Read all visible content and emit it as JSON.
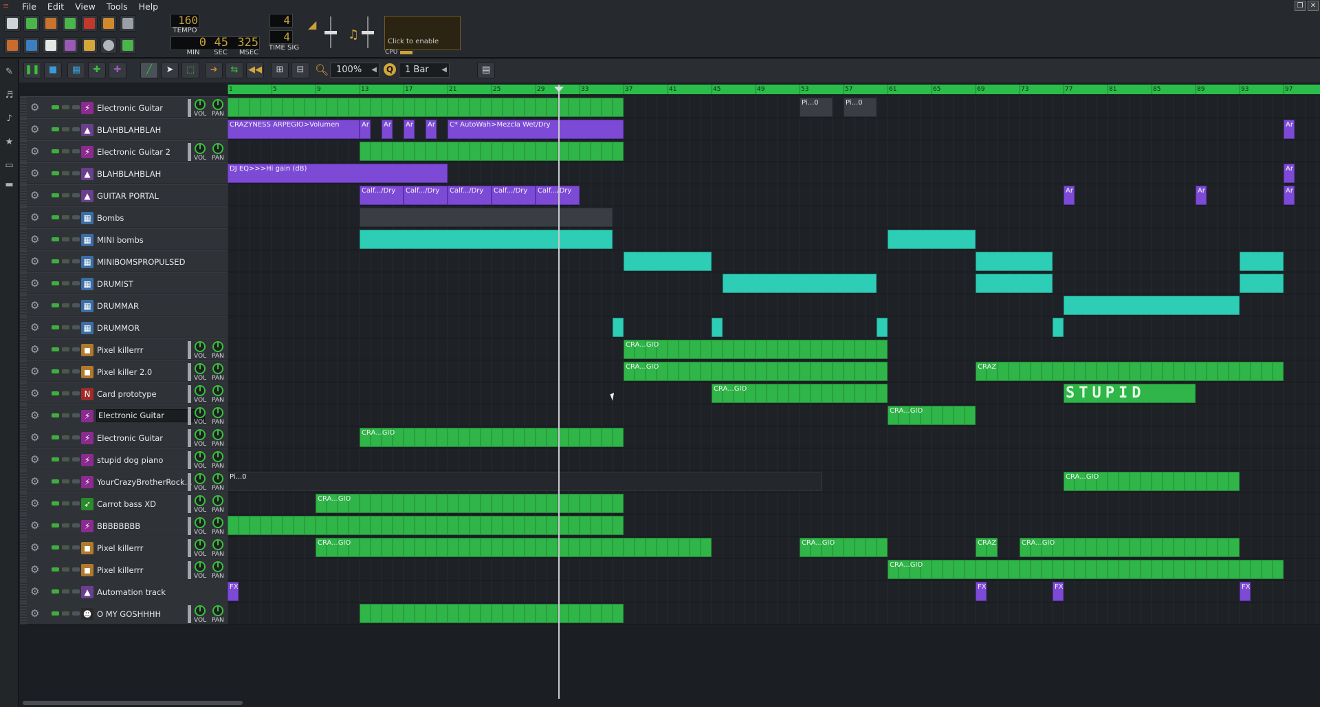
{
  "menu": {
    "items": [
      "File",
      "Edit",
      "View",
      "Tools",
      "Help"
    ]
  },
  "transport": {
    "tempo_value": "160",
    "tempo_label": "TEMPO",
    "min_value": "0",
    "min_label": "MIN",
    "sec_value": "45",
    "sec_label": "SEC",
    "msec_value": "325",
    "msec_label": "MSEC",
    "timesig_num": "4",
    "timesig_den": "4",
    "timesig_label": "TIME SIG",
    "cpu_hint": "Click to enable",
    "cpu_label": "CPU"
  },
  "editor_toolbar": {
    "zoom_value": "100%",
    "quantize_label": "Q",
    "quantize_value": "1 Bar"
  },
  "ruler": {
    "ticks": [
      "1",
      "5",
      "9",
      "13",
      "17",
      "21",
      "25",
      "29",
      "33",
      "37",
      "41",
      "45",
      "49",
      "53",
      "57",
      "61",
      "65",
      "69",
      "73",
      "77",
      "81",
      "85",
      "89",
      "93",
      "97"
    ]
  },
  "tracks": [
    {
      "name": "Electronic Guitar",
      "icon": "guitar-plugin-icon",
      "color": "#8b2a8f",
      "vol": "VOL",
      "pan": "PAN",
      "knobs": true
    },
    {
      "name": "BLAHBLAHBLAH",
      "icon": "automation-icon",
      "color": "#6a3f8c",
      "knobs": false
    },
    {
      "name": "Electronic Guitar 2",
      "icon": "guitar-plugin-icon",
      "color": "#8b2a8f",
      "vol": "VOL",
      "pan": "PAN",
      "knobs": true
    },
    {
      "name": "BLAHBLAHBLAH",
      "icon": "automation-icon",
      "color": "#6a3f8c",
      "knobs": false
    },
    {
      "name": "GUITAR PORTAL",
      "icon": "automation-icon",
      "color": "#6a3f8c",
      "knobs": false
    },
    {
      "name": "Bombs",
      "icon": "pattern-icon",
      "color": "#3b6ea5",
      "knobs": false
    },
    {
      "name": "MINI bombs",
      "icon": "pattern-icon",
      "color": "#3b6ea5",
      "knobs": false
    },
    {
      "name": "MINIBOMSPROPULSED",
      "icon": "pattern-icon",
      "color": "#3b6ea5",
      "knobs": false
    },
    {
      "name": "DRUMIST",
      "icon": "pattern-icon",
      "color": "#3b6ea5",
      "knobs": false
    },
    {
      "name": "DRUMMAR",
      "icon": "pattern-icon",
      "color": "#3b6ea5",
      "knobs": false
    },
    {
      "name": "DRUMMOR",
      "icon": "pattern-icon",
      "color": "#3b6ea5",
      "knobs": false
    },
    {
      "name": "Pixel killerrr",
      "icon": "sampler-icon",
      "color": "#b07a2c",
      "vol": "VOL",
      "pan": "PAN",
      "knobs": true
    },
    {
      "name": "Pixel killer 2.0",
      "icon": "sampler-icon",
      "color": "#b07a2c",
      "vol": "VOL",
      "pan": "PAN",
      "knobs": true
    },
    {
      "name": "Card prototype",
      "icon": "nes-icon",
      "color": "#a02a2a",
      "vol": "VOL",
      "pan": "PAN",
      "knobs": true
    },
    {
      "name": "Electronic Guitar",
      "icon": "guitar-plugin-icon",
      "color": "#8b2a8f",
      "vol": "VOL",
      "pan": "PAN",
      "knobs": true,
      "selected": true
    },
    {
      "name": "Electronic Guitar",
      "icon": "guitar-plugin-icon",
      "color": "#8b2a8f",
      "vol": "VOL",
      "pan": "PAN",
      "knobs": true
    },
    {
      "name": "stupid dog piano",
      "icon": "guitar-plugin-icon",
      "color": "#8b2a8f",
      "vol": "VOL",
      "pan": "PAN",
      "knobs": true
    },
    {
      "name": "YourCrazyBrotherRock...",
      "icon": "guitar-plugin-icon",
      "color": "#8b2a8f",
      "vol": "VOL",
      "pan": "PAN",
      "knobs": true
    },
    {
      "name": "Carrot bass XD",
      "icon": "carrot-icon",
      "color": "#2b8a2b",
      "vol": "VOL",
      "pan": "PAN",
      "knobs": true
    },
    {
      "name": "BBBBBBBB",
      "icon": "guitar-plugin-icon",
      "color": "#8b2a8f",
      "vol": "VOL",
      "pan": "PAN",
      "knobs": true
    },
    {
      "name": "Pixel killerrr",
      "icon": "sampler-icon",
      "color": "#b07a2c",
      "vol": "VOL",
      "pan": "PAN",
      "knobs": true
    },
    {
      "name": "Pixel killerrr",
      "icon": "sampler-icon",
      "color": "#b07a2c",
      "vol": "VOL",
      "pan": "PAN",
      "knobs": true
    },
    {
      "name": "Automation track",
      "icon": "automation-icon",
      "color": "#6a3f8c",
      "knobs": false
    },
    {
      "name": "O MY GOSHHHH",
      "icon": "alien-icon",
      "color": "#2a2a2a",
      "vol": "VOL",
      "pan": "PAN",
      "knobs": true
    }
  ],
  "clips": [
    {
      "row": 0,
      "start": 1,
      "len": 36,
      "kind": "green",
      "label": ""
    },
    {
      "row": 0,
      "start": 53,
      "len": 3,
      "kind": "gray",
      "label": "Pi...0"
    },
    {
      "row": 0,
      "start": 57,
      "len": 3,
      "kind": "gray",
      "label": "Pi...0"
    },
    {
      "row": 1,
      "start": 1,
      "len": 12,
      "kind": "purple",
      "label": "CRAZYNESS ARPEGIO>Volumen"
    },
    {
      "row": 1,
      "start": 13,
      "len": 1,
      "kind": "purple",
      "label": "Ar"
    },
    {
      "row": 1,
      "start": 15,
      "len": 1,
      "kind": "purple",
      "label": "Ar"
    },
    {
      "row": 1,
      "start": 17,
      "len": 1,
      "kind": "purple",
      "label": "Ar"
    },
    {
      "row": 1,
      "start": 19,
      "len": 1,
      "kind": "purple",
      "label": "Ar"
    },
    {
      "row": 1,
      "start": 21,
      "len": 16,
      "kind": "purple",
      "label": "C* AutoWah>Mezcla Wet/Dry"
    },
    {
      "row": 1,
      "start": 97,
      "len": 1,
      "kind": "purple",
      "label": "Ar"
    },
    {
      "row": 2,
      "start": 13,
      "len": 24,
      "kind": "green",
      "label": ""
    },
    {
      "row": 3,
      "start": 1,
      "len": 20,
      "kind": "purple",
      "label": "DJ EQ>>>Hi gain (dB)"
    },
    {
      "row": 3,
      "start": 97,
      "len": 1,
      "kind": "purple",
      "label": "Ar"
    },
    {
      "row": 4,
      "start": 13,
      "len": 4,
      "kind": "purple",
      "label": "Calf.../Dry"
    },
    {
      "row": 4,
      "start": 17,
      "len": 4,
      "kind": "purple",
      "label": "Calf.../Dry"
    },
    {
      "row": 4,
      "start": 21,
      "len": 4,
      "kind": "purple",
      "label": "Calf.../Dry"
    },
    {
      "row": 4,
      "start": 25,
      "len": 4,
      "kind": "purple",
      "label": "Calf.../Dry"
    },
    {
      "row": 4,
      "start": 29,
      "len": 4,
      "kind": "purple",
      "label": "Calf.../Dry"
    },
    {
      "row": 4,
      "start": 77,
      "len": 1,
      "kind": "purple",
      "label": "Ar"
    },
    {
      "row": 4,
      "start": 89,
      "len": 1,
      "kind": "purple",
      "label": "Ar"
    },
    {
      "row": 4,
      "start": 97,
      "len": 1,
      "kind": "purple",
      "label": "Ar"
    },
    {
      "row": 5,
      "start": 13,
      "len": 23,
      "kind": "gray",
      "label": ""
    },
    {
      "row": 6,
      "start": 13,
      "len": 23,
      "kind": "teal",
      "label": ""
    },
    {
      "row": 6,
      "start": 61,
      "len": 8,
      "kind": "teal",
      "label": ""
    },
    {
      "row": 7,
      "start": 37,
      "len": 8,
      "kind": "teal",
      "label": ""
    },
    {
      "row": 7,
      "start": 69,
      "len": 7,
      "kind": "teal",
      "label": ""
    },
    {
      "row": 7,
      "start": 93,
      "len": 4,
      "kind": "teal",
      "label": ""
    },
    {
      "row": 8,
      "start": 46,
      "len": 14,
      "kind": "teal",
      "label": ""
    },
    {
      "row": 8,
      "start": 69,
      "len": 7,
      "kind": "teal",
      "label": ""
    },
    {
      "row": 8,
      "start": 93,
      "len": 4,
      "kind": "teal",
      "label": ""
    },
    {
      "row": 9,
      "start": 77,
      "len": 16,
      "kind": "teal",
      "label": ""
    },
    {
      "row": 10,
      "start": 36,
      "len": 1,
      "kind": "teal",
      "label": ""
    },
    {
      "row": 10,
      "start": 45,
      "len": 1,
      "kind": "teal",
      "label": ""
    },
    {
      "row": 10,
      "start": 60,
      "len": 1,
      "kind": "teal",
      "label": ""
    },
    {
      "row": 10,
      "start": 76,
      "len": 1,
      "kind": "teal",
      "label": ""
    },
    {
      "row": 11,
      "start": 37,
      "len": 24,
      "kind": "green",
      "label": "CRA...GIO"
    },
    {
      "row": 12,
      "start": 37,
      "len": 24,
      "kind": "green",
      "label": "CRA...GIO"
    },
    {
      "row": 12,
      "start": 69,
      "len": 28,
      "kind": "green",
      "label": "CRAZ"
    },
    {
      "row": 13,
      "start": 45,
      "len": 16,
      "kind": "green",
      "label": "CRA...GIO"
    },
    {
      "row": 13,
      "start": 77,
      "len": 12,
      "kind": "stupid",
      "label": "STUPID"
    },
    {
      "row": 14,
      "start": 61,
      "len": 8,
      "kind": "green",
      "label": "CRA...GIO"
    },
    {
      "row": 15,
      "start": 13,
      "len": 24,
      "kind": "green",
      "label": "CRA...GIO"
    },
    {
      "row": 17,
      "start": 1,
      "len": 54,
      "kind": "dark",
      "label": "Pi...0"
    },
    {
      "row": 17,
      "start": 77,
      "len": 16,
      "kind": "green",
      "label": "CRA...GIO"
    },
    {
      "row": 18,
      "start": 9,
      "len": 28,
      "kind": "green",
      "label": "CRA...GIO"
    },
    {
      "row": 19,
      "start": 1,
      "len": 36,
      "kind": "green",
      "label": ""
    },
    {
      "row": 20,
      "start": 9,
      "len": 36,
      "kind": "green",
      "label": "CRA...GIO"
    },
    {
      "row": 20,
      "start": 53,
      "len": 8,
      "kind": "green",
      "label": "CRA...GIO"
    },
    {
      "row": 20,
      "start": 69,
      "len": 2,
      "kind": "green",
      "label": "CRAZ"
    },
    {
      "row": 20,
      "start": 73,
      "len": 20,
      "kind": "green",
      "label": "CRA...GIO"
    },
    {
      "row": 21,
      "start": 61,
      "len": 36,
      "kind": "green",
      "label": "CRA...GIO"
    },
    {
      "row": 22,
      "start": 1,
      "len": 1,
      "kind": "purple",
      "label": "FX"
    },
    {
      "row": 22,
      "start": 69,
      "len": 1,
      "kind": "purple",
      "label": "FX"
    },
    {
      "row": 22,
      "start": 76,
      "len": 1,
      "kind": "purple",
      "label": "FX"
    },
    {
      "row": 22,
      "start": 93,
      "len": 1,
      "kind": "purple",
      "label": "FX"
    },
    {
      "row": 23,
      "start": 13,
      "len": 24,
      "kind": "green",
      "label": ""
    }
  ],
  "colors": {
    "accent_green": "#2fb548",
    "automation_purple": "#7d4ad6",
    "pattern_teal": "#2ecdb5",
    "ruler_green": "#2bbd4a"
  }
}
